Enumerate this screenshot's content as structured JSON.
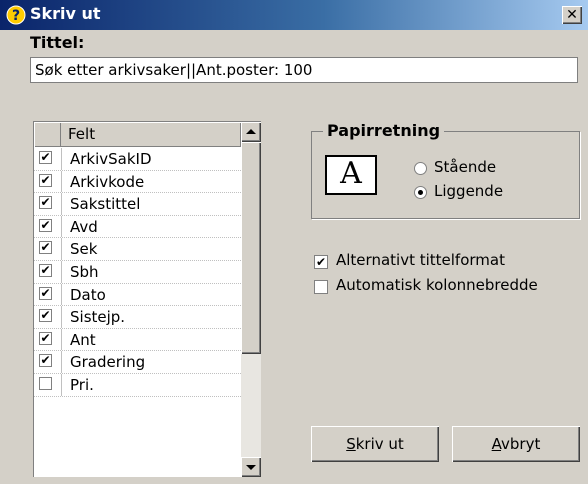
{
  "window": {
    "title": "Skriv ut",
    "close_glyph": "✕"
  },
  "title_section": {
    "label": "Tittel:",
    "value": "Søk etter arkivsaker||Ant.poster: 100"
  },
  "fields": {
    "header": "Felt",
    "items": [
      {
        "label": "ArkivSakID",
        "checked": true
      },
      {
        "label": "Arkivkode",
        "checked": true
      },
      {
        "label": "Sakstittel",
        "checked": true
      },
      {
        "label": "Avd",
        "checked": true
      },
      {
        "label": "Sek",
        "checked": true
      },
      {
        "label": "Sbh",
        "checked": true
      },
      {
        "label": "Dato",
        "checked": true
      },
      {
        "label": "Sistejp.",
        "checked": true
      },
      {
        "label": "Ant",
        "checked": true
      },
      {
        "label": "Gradering",
        "checked": true
      },
      {
        "label": "Pri.",
        "checked": false
      }
    ]
  },
  "paper": {
    "legend": "Papirretning",
    "icon_letter": "A",
    "options": [
      {
        "label": "Stående",
        "selected": false
      },
      {
        "label": "Liggende",
        "selected": true
      }
    ]
  },
  "options": {
    "alt_title": {
      "label": "Alternativt tittelformat",
      "checked": true
    },
    "auto_width": {
      "label": "Automatisk kolonnebredde",
      "checked": false
    }
  },
  "buttons": {
    "print_underline": "S",
    "print_rest": "kriv ut",
    "cancel_underline": "A",
    "cancel_rest": "vbryt"
  },
  "colors": {
    "titlebar_start": "#0a246a",
    "titlebar_end": "#a6caf0",
    "face": "#d4d0c8"
  }
}
